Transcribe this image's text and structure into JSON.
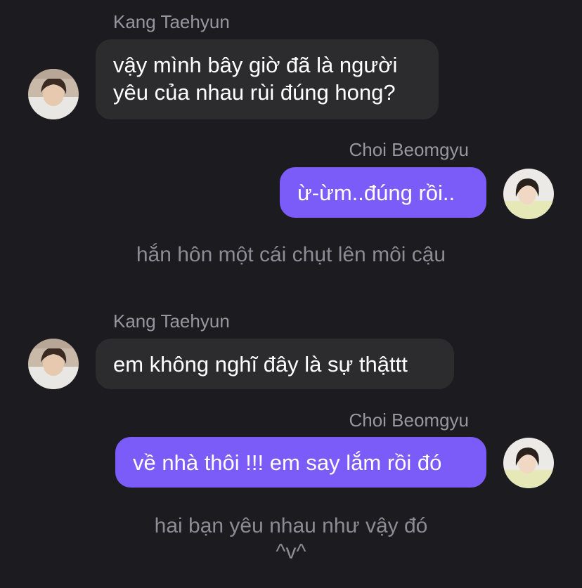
{
  "messages": [
    {
      "sender": "Kang Taehyun",
      "avatar_icon": "profile-photo-icon",
      "lines": [
        "vậy mình bây giờ đã là người",
        "yêu của nhau rùi đúng hong?"
      ]
    },
    {
      "sender": "Choi Beomgyu",
      "avatar_icon": "profile-photo-icon",
      "lines": [
        "ừ-ừm..đúng rồi.."
      ]
    },
    {
      "narration": "hắn hôn một cái chụt lên môi cậu"
    },
    {
      "sender": "Kang Taehyun",
      "avatar_icon": "profile-photo-icon",
      "lines": [
        "em không nghĩ đây là sự thậttt"
      ]
    },
    {
      "sender": "Choi Beomgyu",
      "avatar_icon": "profile-photo-icon",
      "lines": [
        "về nhà thôi !!! em say lắm rồi đó"
      ]
    },
    {
      "narration_lines": [
        "hai bạn yêu nhau như vậy đó",
        "^v^"
      ]
    }
  ],
  "colors": {
    "background": "#1c1b1f",
    "incoming_bubble": "#2c2c2f",
    "outgoing_bubble": "#7c5cf8",
    "name_text": "#98979d",
    "narration_text": "#8d8c92"
  }
}
